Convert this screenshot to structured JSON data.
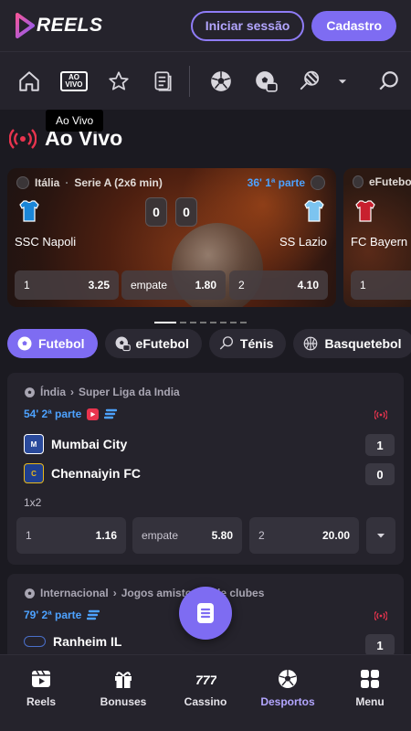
{
  "header": {
    "logo": "REELS",
    "login_label": "Iniciar sessão",
    "register_label": "Cadastro"
  },
  "iconnav": {
    "items": [
      "home-icon",
      "ao-vivo-icon",
      "star-icon",
      "betslip-icon",
      "football-icon",
      "football-tv-icon",
      "tennis-icon",
      "chevron-down-icon",
      "search-icon"
    ],
    "live_badge_line1": "AO",
    "live_badge_line2": "VIVO",
    "tooltip": "Ao Vivo"
  },
  "live": {
    "title": "Ao Vivo"
  },
  "featured": [
    {
      "country": "Itália",
      "league": "Serie A (2x6 min)",
      "time": "36' 1ª parte",
      "home": "SSC Napoli",
      "away": "SS Lazio",
      "home_score": "0",
      "away_score": "0",
      "odds": [
        {
          "label": "1",
          "value": "3.25"
        },
        {
          "label": "empate",
          "value": "1.80"
        },
        {
          "label": "2",
          "value": "4.10"
        }
      ]
    },
    {
      "country": "eFutebol",
      "home": "FC Bayern",
      "odds": [
        {
          "label": "1"
        }
      ]
    }
  ],
  "carousel": {
    "pages": 8,
    "active": 0
  },
  "sport_tabs": [
    {
      "label": "Futebol",
      "icon": "football-icon",
      "active": true
    },
    {
      "label": "eFutebol",
      "icon": "efootball-icon",
      "active": false
    },
    {
      "label": "Ténis",
      "icon": "tennis-icon",
      "active": false
    },
    {
      "label": "Basquetebol",
      "icon": "basketball-icon",
      "active": false
    }
  ],
  "matches": [
    {
      "country": "Índia",
      "league": "Super Liga da India",
      "time": "54' 2ª parte",
      "home": "Mumbai City",
      "away": "Chennaiyin FC",
      "home_score": "1",
      "away_score": "0",
      "market": "1x2",
      "odds": [
        {
          "label": "1",
          "value": "1.16"
        },
        {
          "label": "empate",
          "value": "5.80"
        },
        {
          "label": "2",
          "value": "20.00"
        }
      ]
    },
    {
      "country": "Internacional",
      "league": "Jogos amistosos de clubes",
      "time": "79' 2ª parte",
      "home": "Ranheim IL",
      "home_score": "1"
    }
  ],
  "bottom_nav": [
    {
      "label": "Reels",
      "icon": "reels-icon",
      "active": false
    },
    {
      "label": "Bonuses",
      "icon": "gift-icon",
      "active": false
    },
    {
      "label": "Cassino",
      "icon": "casino-icon",
      "active": false
    },
    {
      "label": "Desportos",
      "icon": "football-icon",
      "active": true
    },
    {
      "label": "Menu",
      "icon": "menu-grid-icon",
      "active": false
    }
  ],
  "colors": {
    "accent": "#7e6cf2",
    "live_red": "#e8344e",
    "time_blue": "#4da2ff",
    "bg": "#1b1a21",
    "panel": "#25232c"
  }
}
